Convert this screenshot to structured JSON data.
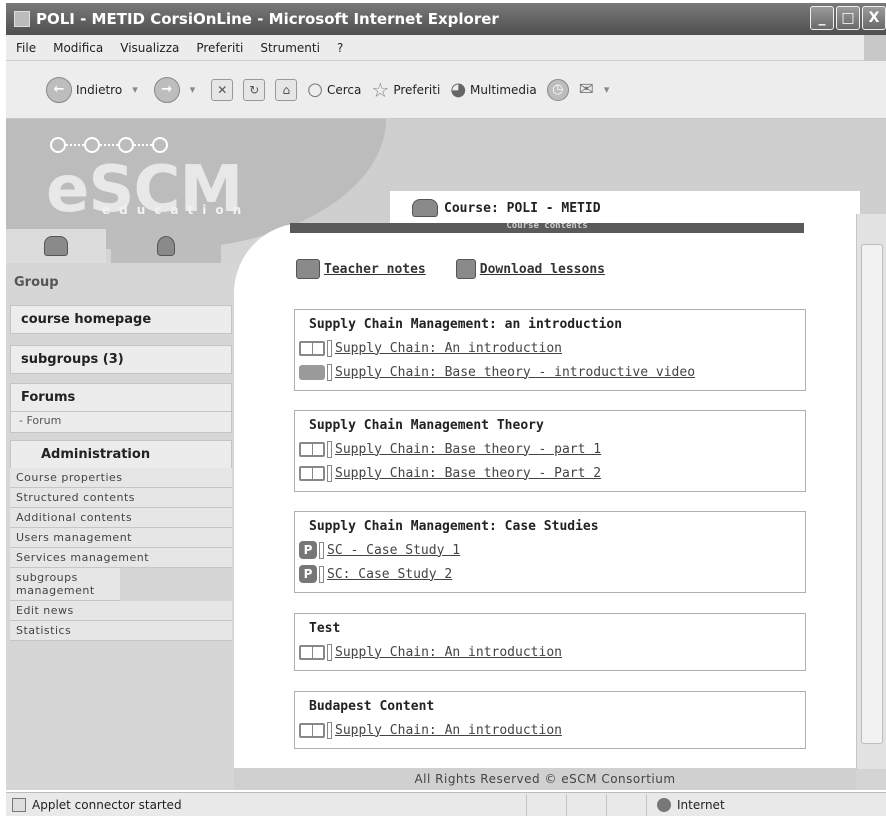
{
  "window": {
    "title": "POLI - METID CorsiOnLine - Microsoft Internet Explorer",
    "controls": [
      "_",
      "□",
      "X"
    ]
  },
  "menu": [
    "File",
    "Modifica",
    "Visualizza",
    "Preferiti",
    "Strumenti",
    "?"
  ],
  "toolbar": {
    "back_label": "Indietro",
    "search_label": "Cerca",
    "favorites_label": "Preferiti",
    "multimedia_label": "Multimedia"
  },
  "logo": {
    "main": "eSCM",
    "sub": "education"
  },
  "sidebar": {
    "group_label": "Group",
    "course_homepage": "course homepage",
    "subgroups": "subgroups (3)",
    "forums_heading": "Forums",
    "forum_link": "- Forum",
    "administration_heading": "Administration",
    "admin_items": [
      "Course properties",
      "Structured contents",
      "Additional contents",
      "Users management",
      "Services management",
      "subgroups management",
      "Edit news",
      "Statistics"
    ]
  },
  "course": {
    "tab_title": "Course: POLI - METID",
    "contents_bar": "Course contents",
    "teacher_notes": "Teacher notes",
    "download_lessons": "Download lessons"
  },
  "sections": [
    {
      "title": "Supply Chain Management: an introduction",
      "items": [
        {
          "icon": "book-icon",
          "label": "Supply Chain: An introduction"
        },
        {
          "icon": "video-icon",
          "label": "Supply Chain: Base theory - introductive video"
        }
      ]
    },
    {
      "title": "Supply Chain Management Theory",
      "items": [
        {
          "icon": "book-icon",
          "label": "Supply Chain: Base theory - part 1"
        },
        {
          "icon": "book-icon",
          "label": "Supply Chain: Base theory - Part 2"
        }
      ]
    },
    {
      "title": "Supply Chain Management: Case Studies",
      "items": [
        {
          "icon": "p-icon",
          "label": "SC - Case Study 1"
        },
        {
          "icon": "p-icon",
          "label": "SC: Case Study 2"
        }
      ]
    },
    {
      "title": "Test",
      "items": [
        {
          "icon": "book-icon",
          "label": "Supply Chain: An introduction"
        }
      ]
    },
    {
      "title": "Budapest Content",
      "items": [
        {
          "icon": "book-icon",
          "label": "Supply Chain: An introduction"
        }
      ]
    }
  ],
  "footer": "All Rights Reserved © eSCM Consortium",
  "status": {
    "message": "Applet connector started",
    "zone": "Internet"
  }
}
